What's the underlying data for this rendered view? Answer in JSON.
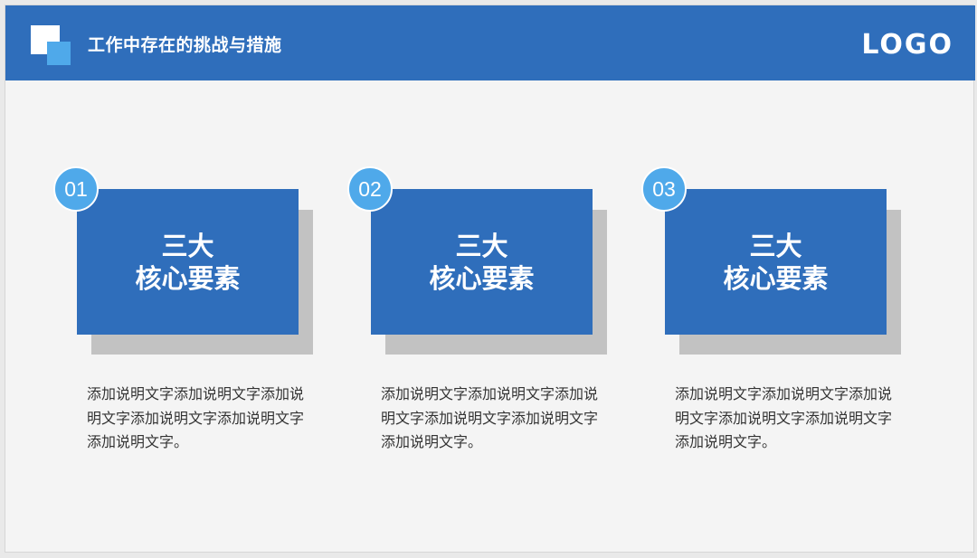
{
  "header": {
    "title": "工作中存在的挑战与措施",
    "logo_text": "LOGO",
    "accent_color": "#2f6ebb",
    "logo_mark_colors": [
      "#ffffff",
      "#4fa9ea"
    ]
  },
  "cards": [
    {
      "number": "01",
      "heading_line1": "三大",
      "heading_line2": "核心要素",
      "description": "添加说明文字添加说明文字添加说明文字添加说明文字添加说明文字添加说明文字。"
    },
    {
      "number": "02",
      "heading_line1": "三大",
      "heading_line2": "核心要素",
      "description": "添加说明文字添加说明文字添加说明文字添加说明文字添加说明文字添加说明文字。"
    },
    {
      "number": "03",
      "heading_line1": "三大",
      "heading_line2": "核心要素",
      "description": "添加说明文字添加说明文字添加说明文字添加说明文字添加说明文字添加说明文字。"
    }
  ]
}
